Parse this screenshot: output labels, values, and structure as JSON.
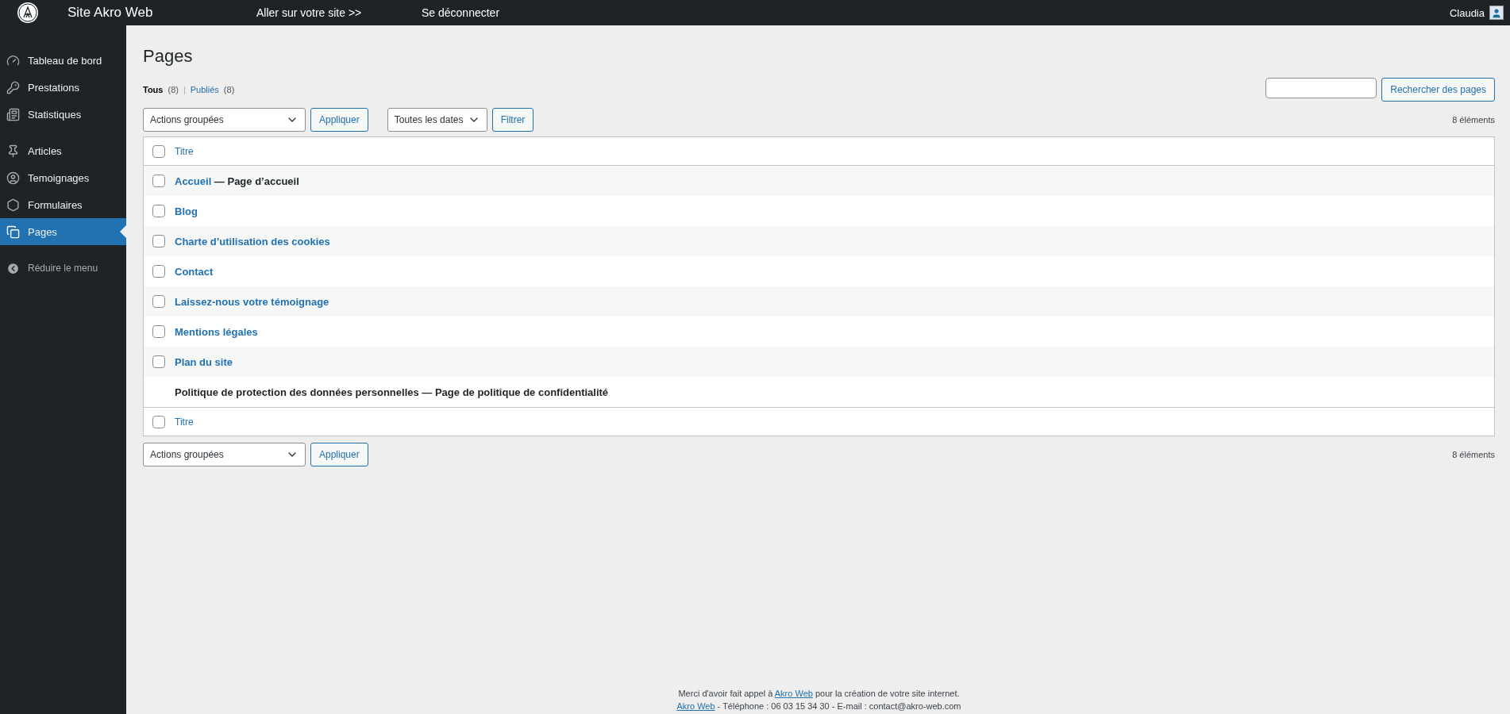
{
  "topbar": {
    "site_title": "Site Akro Web",
    "links": [
      "Aller sur votre site >>",
      "Se déconnecter"
    ],
    "user": "Claudia"
  },
  "sidebar": {
    "groups": [
      [
        {
          "label": "Tableau de bord",
          "selected": false
        },
        {
          "label": "Prestations",
          "selected": false
        },
        {
          "label": "Statistiques",
          "selected": false
        }
      ],
      [
        {
          "label": "Articles",
          "selected": false
        },
        {
          "label": "Temoignages",
          "selected": false
        },
        {
          "label": "Formulaires",
          "selected": false
        },
        {
          "label": "Pages",
          "selected": true
        }
      ]
    ],
    "collapse": "Réduire le menu"
  },
  "page": {
    "title": "Pages",
    "views": [
      {
        "label": "Tous",
        "count": "(8)",
        "selected": true
      },
      {
        "label": "Publiés",
        "count": "(8)",
        "selected": false
      }
    ],
    "views_separator": "|",
    "search_button": "Rechercher des pages",
    "bulk_action": "Actions groupées",
    "apply": "Appliquer",
    "date_filter": "Toutes les dates",
    "filter": "Filtrer",
    "count": "8 éléments",
    "table": {
      "column": "Titre",
      "footer_column": "Titre",
      "header_checked": false,
      "footer_checked": false,
      "rows": [
        {
          "title": "Accueil",
          "suffix": " — Page d’accueil",
          "kind": "page",
          "checked": false
        },
        {
          "title": "Blog",
          "kind": "page",
          "checked": false
        },
        {
          "title": "Charte d’utilisation des cookies",
          "kind": "page",
          "checked": false
        },
        {
          "title": "Contact",
          "kind": "page",
          "checked": false
        },
        {
          "title": "Laissez-nous votre témoignage",
          "kind": "page",
          "checked": false
        },
        {
          "title": "Mentions légales",
          "kind": "page",
          "checked": false
        },
        {
          "title": "Plan du site",
          "kind": "page",
          "checked": false
        },
        {
          "title": "Politique de protection des données personnelles — Page de politique de confidentialité",
          "kind": "locked"
        }
      ]
    },
    "bottom_bulk_action": "Actions groupées",
    "bottom_apply": "Appliquer",
    "bottom_count": "8 éléments"
  },
  "footer": {
    "lines": [
      [
        {
          "kind": "text",
          "text": "Merci d'avoir fait appel à "
        },
        {
          "kind": "link",
          "text": "Akro Web"
        },
        {
          "kind": "text",
          "text": " pour la création de votre site internet."
        }
      ],
      [
        {
          "kind": "link",
          "text": "Akro Web"
        },
        {
          "kind": "text",
          "text": " - Téléphone : 06 03 15 34 30 - E-mail : contact@akro-web.com"
        }
      ]
    ]
  }
}
